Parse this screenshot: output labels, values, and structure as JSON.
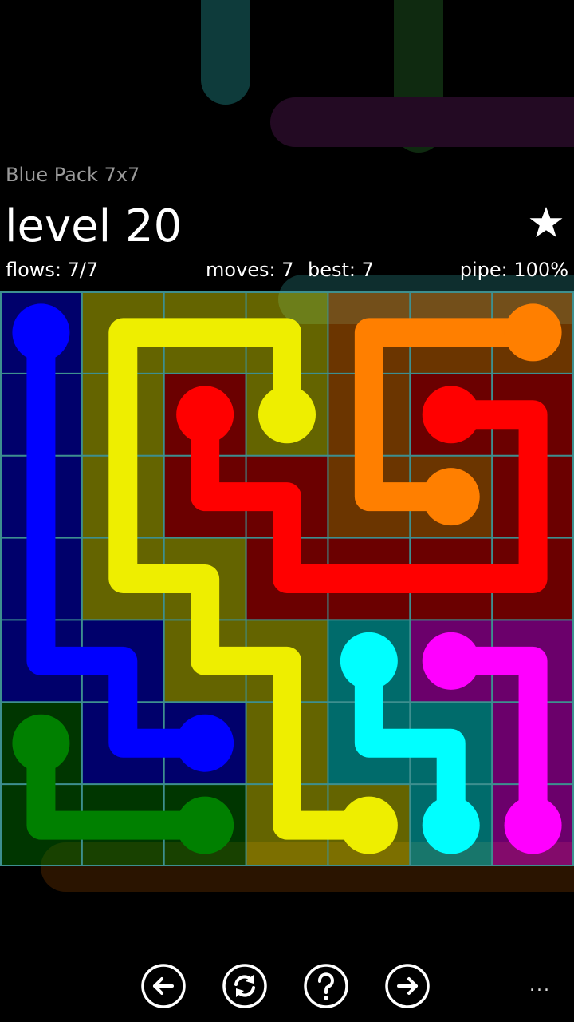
{
  "header": {
    "pack_title": "Blue Pack 7x7",
    "level_title": "level 20",
    "flows": "flows: 7/7",
    "moves": "moves: 7",
    "best": "best: 7",
    "pipe": "pipe: 100%",
    "star_icon": "star-icon"
  },
  "board": {
    "size": 7,
    "cell_fills": [
      [
        "blue",
        "yellow",
        "yellow",
        "yellow",
        "orange",
        "orange",
        "orange"
      ],
      [
        "blue",
        "yellow",
        "red",
        "yellow",
        "orange",
        "red",
        "red"
      ],
      [
        "blue",
        "yellow",
        "red",
        "red",
        "orange",
        "orange",
        "red"
      ],
      [
        "blue",
        "yellow",
        "yellow",
        "red",
        "red",
        "red",
        "red"
      ],
      [
        "blue",
        "blue",
        "yellow",
        "yellow",
        "cyan",
        "magenta",
        "magenta"
      ],
      [
        "green",
        "blue",
        "blue",
        "yellow",
        "cyan",
        "cyan",
        "magenta"
      ],
      [
        "green",
        "green",
        "green",
        "yellow",
        "yellow",
        "cyan",
        "magenta"
      ]
    ],
    "flows": [
      {
        "name": "blue",
        "color": "#0000ff",
        "path": [
          [
            0,
            0
          ],
          [
            1,
            0
          ],
          [
            2,
            0
          ],
          [
            3,
            0
          ],
          [
            4,
            0
          ],
          [
            4,
            1
          ],
          [
            5,
            1
          ],
          [
            5,
            2
          ]
        ]
      },
      {
        "name": "yellow",
        "color": "#eeee00",
        "path": [
          [
            1,
            3
          ],
          [
            0,
            3
          ],
          [
            0,
            2
          ],
          [
            0,
            1
          ],
          [
            1,
            1
          ],
          [
            2,
            1
          ],
          [
            3,
            1
          ],
          [
            3,
            2
          ],
          [
            4,
            2
          ],
          [
            4,
            3
          ],
          [
            5,
            3
          ],
          [
            6,
            3
          ],
          [
            6,
            4
          ]
        ]
      },
      {
        "name": "red",
        "color": "#ff0000",
        "path": [
          [
            1,
            2
          ],
          [
            2,
            2
          ],
          [
            2,
            3
          ],
          [
            3,
            3
          ],
          [
            3,
            4
          ],
          [
            3,
            5
          ],
          [
            3,
            6
          ],
          [
            2,
            6
          ],
          [
            1,
            6
          ],
          [
            1,
            5
          ]
        ]
      },
      {
        "name": "orange",
        "color": "#ff7f00",
        "path": [
          [
            0,
            6
          ],
          [
            0,
            5
          ],
          [
            0,
            4
          ],
          [
            1,
            4
          ],
          [
            2,
            4
          ],
          [
            2,
            5
          ]
        ]
      },
      {
        "name": "cyan",
        "color": "#00ffff",
        "path": [
          [
            4,
            4
          ],
          [
            5,
            4
          ],
          [
            5,
            5
          ],
          [
            6,
            5
          ]
        ]
      },
      {
        "name": "magenta",
        "color": "#ff00ff",
        "path": [
          [
            4,
            5
          ],
          [
            4,
            6
          ],
          [
            5,
            6
          ],
          [
            6,
            6
          ]
        ]
      },
      {
        "name": "green",
        "color": "#008000",
        "path": [
          [
            5,
            0
          ],
          [
            6,
            0
          ],
          [
            6,
            1
          ],
          [
            6,
            2
          ]
        ]
      }
    ]
  },
  "toolbar": {
    "buttons": [
      {
        "name": "previous-level-button",
        "icon": "arrow-left-icon"
      },
      {
        "name": "restart-button",
        "icon": "refresh-icon"
      },
      {
        "name": "hint-button",
        "icon": "help-icon"
      },
      {
        "name": "next-level-button",
        "icon": "arrow-right-icon"
      }
    ],
    "more_label": "..."
  }
}
